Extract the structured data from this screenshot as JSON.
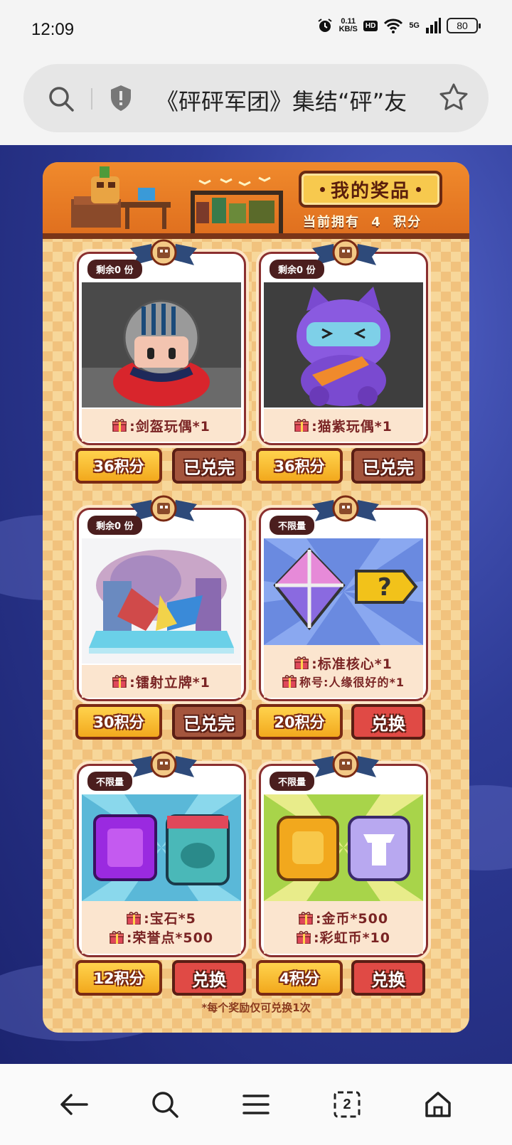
{
  "status_bar": {
    "time": "12:09",
    "net_speed_value": "0.11",
    "net_speed_unit": "KB/S",
    "hd": "HD",
    "network": "5G",
    "battery": "80"
  },
  "address_bar": {
    "title": "《砰砰军团》集结“砰”友",
    "icons": [
      "search-icon",
      "shield-icon",
      "star-icon"
    ]
  },
  "header": {
    "my_prizes": "我的奖品",
    "points_prefix": "当前拥有",
    "points_value": "4",
    "points_suffix": "积分"
  },
  "prizes": [
    {
      "stock_prefix": "剩余",
      "stock_count": "0",
      "stock_suffix": "份",
      "labels": [
        ":剑盔玩偶*1"
      ],
      "points": "36积分",
      "action": "已兑完"
    },
    {
      "stock_prefix": "剩余",
      "stock_count": "0",
      "stock_suffix": "份",
      "labels": [
        ":猫紫玩偶*1"
      ],
      "points": "36积分",
      "action": "已兑完"
    },
    {
      "stock_prefix": "剩余",
      "stock_count": "0",
      "stock_suffix": "份",
      "labels": [
        ":镭射立牌*1"
      ],
      "points": "30积分",
      "action": "已兑完"
    },
    {
      "stock_label": "不限量",
      "labels": [
        ":标准核心*1",
        "称号:人缘很好的*1"
      ],
      "points": "20积分",
      "action": "兑换"
    },
    {
      "stock_label": "不限量",
      "labels": [
        ":宝石*5",
        ":荣誉点*500"
      ],
      "points": "12积分",
      "action": "兑换"
    },
    {
      "stock_label": "不限量",
      "labels": [
        ":金币*500",
        ":彩虹币*10"
      ],
      "points": "4积分",
      "action": "兑换"
    }
  ],
  "footnote": "*每个奖励仅可兑换1次",
  "bottom_nav": {
    "tab_count": "2",
    "icons": [
      "back-icon",
      "search-icon",
      "menu-icon",
      "tabs-icon",
      "home-icon"
    ]
  }
}
